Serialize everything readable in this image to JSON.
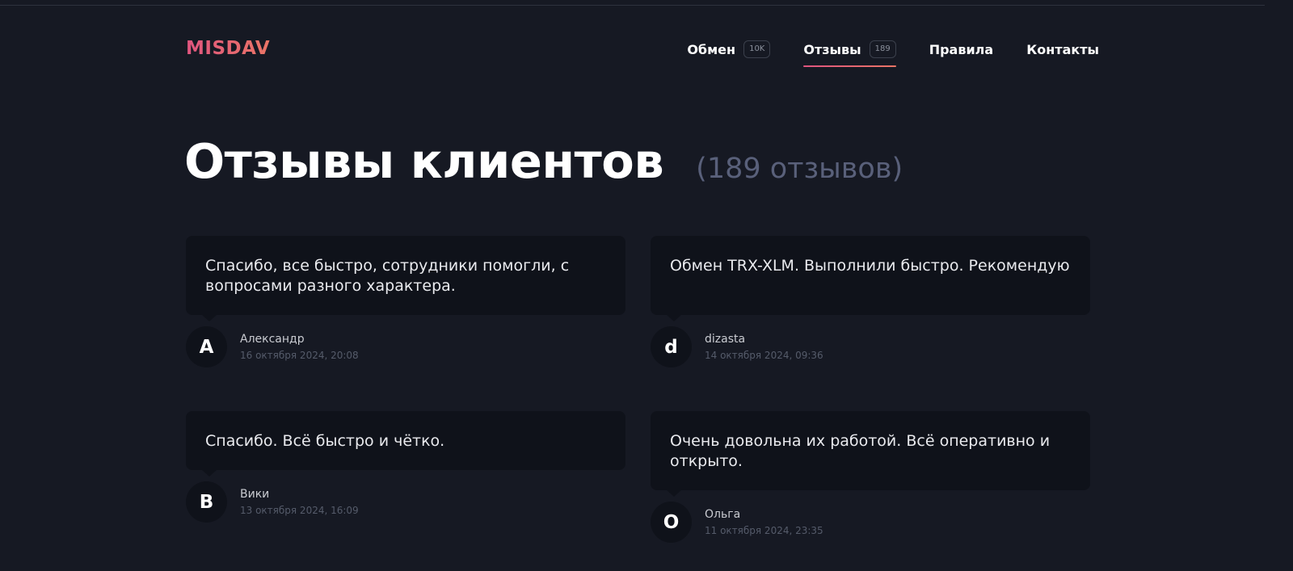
{
  "logo": "MISDAV",
  "nav": [
    {
      "label": "Обмен",
      "badge": "10K"
    },
    {
      "label": "Отзывы",
      "badge": "189"
    },
    {
      "label": "Правила"
    },
    {
      "label": "Контакты"
    }
  ],
  "page": {
    "title": "Отзывы клиентов",
    "count": "(189 отзывов)"
  },
  "reviews": [
    {
      "text": "Спасибо, все быстро, сотрудники помогли, с вопросами разного характера.",
      "initial": "А",
      "name": "Александр",
      "date": "16 октября 2024, 20:08"
    },
    {
      "text": "Обмен TRX-XLM. Выполнили быстро. Рекомендую",
      "initial": "d",
      "name": "dizasta",
      "date": "14 октября 2024, 09:36"
    },
    {
      "text": "Спасибо. Всё быстро и чётко.",
      "initial": "В",
      "name": "Вики",
      "date": "13 октября 2024, 16:09"
    },
    {
      "text": "Очень довольна их работой. Всё оперативно и открыто.",
      "initial": "О",
      "name": "Ольга",
      "date": "11 октября 2024, 23:35"
    }
  ]
}
